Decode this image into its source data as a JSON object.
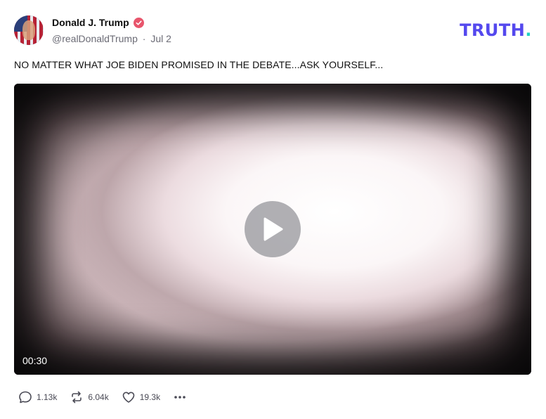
{
  "post": {
    "author_name": "Donald J. Trump",
    "handle": "@realDonaldTrump",
    "separator": "·",
    "date": "Jul 2",
    "text": "NO MATTER WHAT JOE BIDEN PROMISED IN THE DEBATE...ASK YOURSELF..."
  },
  "brand": {
    "logo_text": "TRUTH",
    "logo_dot": ".",
    "color": "#5448ee",
    "dot_color": "#20d3c2"
  },
  "video": {
    "duration": "00:30"
  },
  "actions": {
    "replies": "1.13k",
    "retruths": "6.04k",
    "likes": "19.3k"
  },
  "icons": {
    "verified": "verified-badge-icon",
    "play": "play-icon",
    "reply": "speech-bubble-icon",
    "retruth": "repost-arrows-icon",
    "like": "heart-icon",
    "more": "ellipsis-icon"
  }
}
